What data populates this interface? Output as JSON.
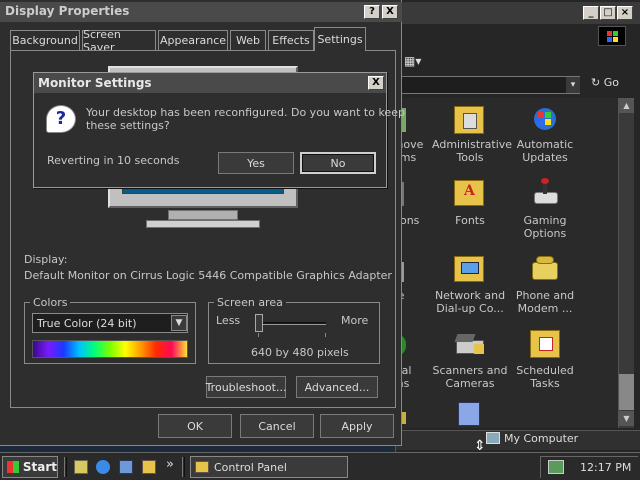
{
  "background_window": {
    "address_go_label": "Go",
    "icons": [
      {
        "label": "…move\n…ms"
      },
      {
        "label": "Administrative Tools"
      },
      {
        "label": "Automatic Updates"
      },
      {
        "label": "…tions"
      },
      {
        "label": "Fonts"
      },
      {
        "label": "Gaming Options"
      },
      {
        "label": "…e"
      },
      {
        "label": "Network and Dial-up Co..."
      },
      {
        "label": "Phone and Modem ..."
      },
      {
        "label": "…nal\n…ns"
      },
      {
        "label": "Scanners and Cameras"
      },
      {
        "label": "Scheduled Tasks"
      }
    ],
    "status_computer": "My Computer"
  },
  "display_properties": {
    "title": "Display Properties",
    "help_btn": "?",
    "close_btn": "X",
    "tabs": [
      "Background",
      "Screen Saver",
      "Appearance",
      "Web",
      "Effects",
      "Settings"
    ],
    "display_label": "Display:",
    "display_value": "Default Monitor on Cirrus Logic 5446 Compatible Graphics Adapter",
    "colors_group": "Colors",
    "colors_value": "True Color (24 bit)",
    "screen_area_group": "Screen area",
    "less_label": "Less",
    "more_label": "More",
    "resolution": "640 by 480 pixels",
    "troubleshoot_btn": "Troubleshoot...",
    "advanced_btn": "Advanced...",
    "ok_btn": "OK",
    "cancel_btn": "Cancel",
    "apply_btn": "Apply"
  },
  "monitor_dialog": {
    "title": "Monitor Settings",
    "close_btn": "X",
    "message_line1": "Your desktop has been reconfigured.  Do you want to keep",
    "message_line2": "these settings?",
    "countdown": "Reverting in 10 seconds",
    "yes_btn": "Yes",
    "no_btn": "No"
  },
  "taskbar": {
    "start_label": "Start",
    "task_label": "Control Panel",
    "clock": "12:17 PM",
    "chevron": "»"
  },
  "colors": {
    "dialog_bg": "#2e2e2e",
    "title_bar": "#4a4a4a",
    "desktop": "#1c2a3a"
  }
}
